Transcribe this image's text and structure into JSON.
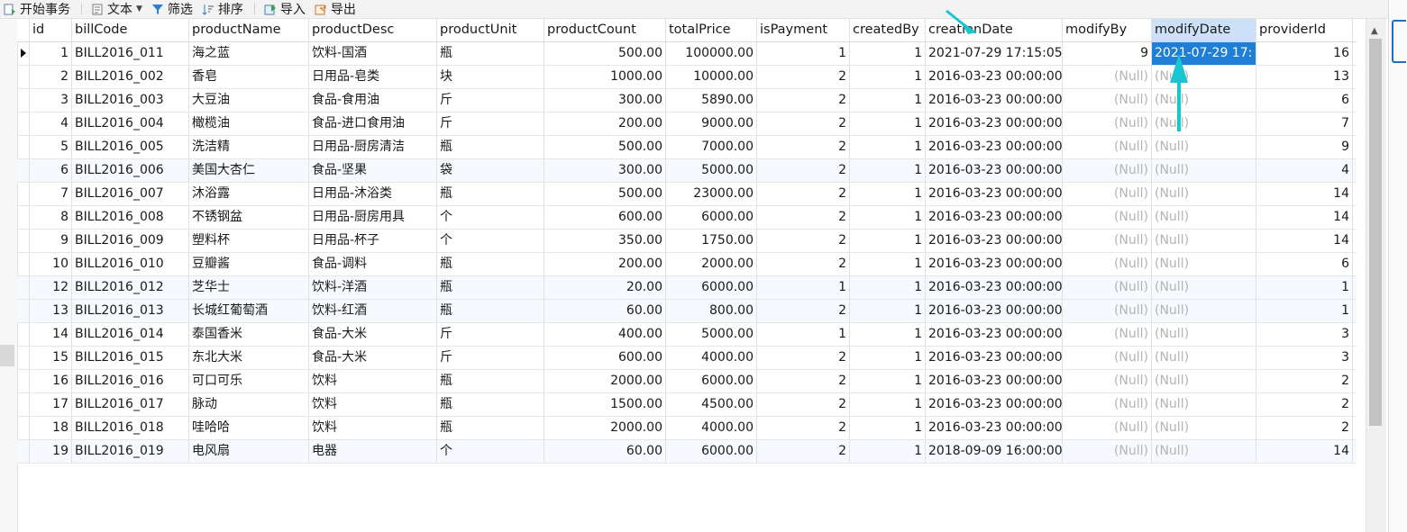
{
  "toolbar": {
    "begin_transaction": "开始事务",
    "text": "文本",
    "filter": "筛选",
    "sort": "排序",
    "import": "导入",
    "export": "导出"
  },
  "colors": {
    "selected_cell": "#1f7ed6",
    "selected_header": "#cce1f7",
    "null_text": "#b4b4b4",
    "arrow": "#18c6cf"
  },
  "columns": [
    "id",
    "billCode",
    "productName",
    "productDesc",
    "productUnit",
    "productCount",
    "totalPrice",
    "isPayment",
    "createdBy",
    "creationDate",
    "modifyBy",
    "modifyDate",
    "providerId"
  ],
  "null_label": "(Null)",
  "rows": [
    {
      "id": "1",
      "billCode": "BILL2016_011",
      "productName": "海之蓝",
      "productDesc": "饮料-国酒",
      "productUnit": "瓶",
      "productCount": "500.00",
      "totalPrice": "100000.00",
      "isPayment": "1",
      "createdBy": "1",
      "creationDate": "2021-07-29 17:15:05",
      "modifyBy": "9",
      "modifyDate": "2021-07-29 17:",
      "providerId": "16"
    },
    {
      "id": "2",
      "billCode": "BILL2016_002",
      "productName": "香皂",
      "productDesc": "日用品-皂类",
      "productUnit": "块",
      "productCount": "1000.00",
      "totalPrice": "10000.00",
      "isPayment": "2",
      "createdBy": "1",
      "creationDate": "2016-03-23 00:00:00",
      "modifyBy": "(Null)",
      "modifyDate": "(Null)",
      "providerId": "13"
    },
    {
      "id": "3",
      "billCode": "BILL2016_003",
      "productName": "大豆油",
      "productDesc": "食品-食用油",
      "productUnit": "斤",
      "productCount": "300.00",
      "totalPrice": "5890.00",
      "isPayment": "2",
      "createdBy": "1",
      "creationDate": "2016-03-23 00:00:00",
      "modifyBy": "(Null)",
      "modifyDate": "(Null)",
      "providerId": "6"
    },
    {
      "id": "4",
      "billCode": "BILL2016_004",
      "productName": "橄榄油",
      "productDesc": "食品-进口食用油",
      "productUnit": "斤",
      "productCount": "200.00",
      "totalPrice": "9000.00",
      "isPayment": "2",
      "createdBy": "1",
      "creationDate": "2016-03-23 00:00:00",
      "modifyBy": "(Null)",
      "modifyDate": "(Null)",
      "providerId": "7"
    },
    {
      "id": "5",
      "billCode": "BILL2016_005",
      "productName": "洗洁精",
      "productDesc": "日用品-厨房清洁",
      "productUnit": "瓶",
      "productCount": "500.00",
      "totalPrice": "7000.00",
      "isPayment": "2",
      "createdBy": "1",
      "creationDate": "2016-03-23 00:00:00",
      "modifyBy": "(Null)",
      "modifyDate": "(Null)",
      "providerId": "9"
    },
    {
      "id": "6",
      "billCode": "BILL2016_006",
      "productName": "美国大杏仁",
      "productDesc": "食品-坚果",
      "productUnit": "袋",
      "productCount": "300.00",
      "totalPrice": "5000.00",
      "isPayment": "2",
      "createdBy": "1",
      "creationDate": "2016-03-23 00:00:00",
      "modifyBy": "(Null)",
      "modifyDate": "(Null)",
      "providerId": "4"
    },
    {
      "id": "7",
      "billCode": "BILL2016_007",
      "productName": "沐浴露",
      "productDesc": "日用品-沐浴类",
      "productUnit": "瓶",
      "productCount": "500.00",
      "totalPrice": "23000.00",
      "isPayment": "2",
      "createdBy": "1",
      "creationDate": "2016-03-23 00:00:00",
      "modifyBy": "(Null)",
      "modifyDate": "(Null)",
      "providerId": "14"
    },
    {
      "id": "8",
      "billCode": "BILL2016_008",
      "productName": "不锈钢盆",
      "productDesc": "日用品-厨房用具",
      "productUnit": "个",
      "productCount": "600.00",
      "totalPrice": "6000.00",
      "isPayment": "2",
      "createdBy": "1",
      "creationDate": "2016-03-23 00:00:00",
      "modifyBy": "(Null)",
      "modifyDate": "(Null)",
      "providerId": "14"
    },
    {
      "id": "9",
      "billCode": "BILL2016_009",
      "productName": "塑料杯",
      "productDesc": "日用品-杯子",
      "productUnit": "个",
      "productCount": "350.00",
      "totalPrice": "1750.00",
      "isPayment": "2",
      "createdBy": "1",
      "creationDate": "2016-03-23 00:00:00",
      "modifyBy": "(Null)",
      "modifyDate": "(Null)",
      "providerId": "14"
    },
    {
      "id": "10",
      "billCode": "BILL2016_010",
      "productName": "豆瓣酱",
      "productDesc": "食品-调料",
      "productUnit": "瓶",
      "productCount": "200.00",
      "totalPrice": "2000.00",
      "isPayment": "2",
      "createdBy": "1",
      "creationDate": "2016-03-23 00:00:00",
      "modifyBy": "(Null)",
      "modifyDate": "(Null)",
      "providerId": "6"
    },
    {
      "id": "12",
      "billCode": "BILL2016_012",
      "productName": "芝华士",
      "productDesc": "饮料-洋酒",
      "productUnit": "瓶",
      "productCount": "20.00",
      "totalPrice": "6000.00",
      "isPayment": "1",
      "createdBy": "1",
      "creationDate": "2016-03-23 00:00:00",
      "modifyBy": "(Null)",
      "modifyDate": "(Null)",
      "providerId": "1"
    },
    {
      "id": "13",
      "billCode": "BILL2016_013",
      "productName": "长城红葡萄酒",
      "productDesc": "饮料-红酒",
      "productUnit": "瓶",
      "productCount": "60.00",
      "totalPrice": "800.00",
      "isPayment": "2",
      "createdBy": "1",
      "creationDate": "2016-03-23 00:00:00",
      "modifyBy": "(Null)",
      "modifyDate": "(Null)",
      "providerId": "1"
    },
    {
      "id": "14",
      "billCode": "BILL2016_014",
      "productName": "泰国香米",
      "productDesc": "食品-大米",
      "productUnit": "斤",
      "productCount": "400.00",
      "totalPrice": "5000.00",
      "isPayment": "1",
      "createdBy": "1",
      "creationDate": "2016-03-23 00:00:00",
      "modifyBy": "(Null)",
      "modifyDate": "(Null)",
      "providerId": "3"
    },
    {
      "id": "15",
      "billCode": "BILL2016_015",
      "productName": "东北大米",
      "productDesc": "食品-大米",
      "productUnit": "斤",
      "productCount": "600.00",
      "totalPrice": "4000.00",
      "isPayment": "2",
      "createdBy": "1",
      "creationDate": "2016-03-23 00:00:00",
      "modifyBy": "(Null)",
      "modifyDate": "(Null)",
      "providerId": "3"
    },
    {
      "id": "16",
      "billCode": "BILL2016_016",
      "productName": "可口可乐",
      "productDesc": "饮料",
      "productUnit": "瓶",
      "productCount": "2000.00",
      "totalPrice": "6000.00",
      "isPayment": "2",
      "createdBy": "1",
      "creationDate": "2016-03-23 00:00:00",
      "modifyBy": "(Null)",
      "modifyDate": "(Null)",
      "providerId": "2"
    },
    {
      "id": "17",
      "billCode": "BILL2016_017",
      "productName": "脉动",
      "productDesc": "饮料",
      "productUnit": "瓶",
      "productCount": "1500.00",
      "totalPrice": "4500.00",
      "isPayment": "2",
      "createdBy": "1",
      "creationDate": "2016-03-23 00:00:00",
      "modifyBy": "(Null)",
      "modifyDate": "(Null)",
      "providerId": "2"
    },
    {
      "id": "18",
      "billCode": "BILL2016_018",
      "productName": "哇哈哈",
      "productDesc": "饮料",
      "productUnit": "瓶",
      "productCount": "2000.00",
      "totalPrice": "4000.00",
      "isPayment": "2",
      "createdBy": "1",
      "creationDate": "2016-03-23 00:00:00",
      "modifyBy": "(Null)",
      "modifyDate": "(Null)",
      "providerId": "2"
    },
    {
      "id": "19",
      "billCode": "BILL2016_019",
      "productName": "电风扇",
      "productDesc": "电器",
      "productUnit": "个",
      "productCount": "60.00",
      "totalPrice": "6000.00",
      "isPayment": "2",
      "createdBy": "1",
      "creationDate": "2018-09-09 16:00:00",
      "modifyBy": "(Null)",
      "modifyDate": "(Null)",
      "providerId": "14"
    }
  ]
}
